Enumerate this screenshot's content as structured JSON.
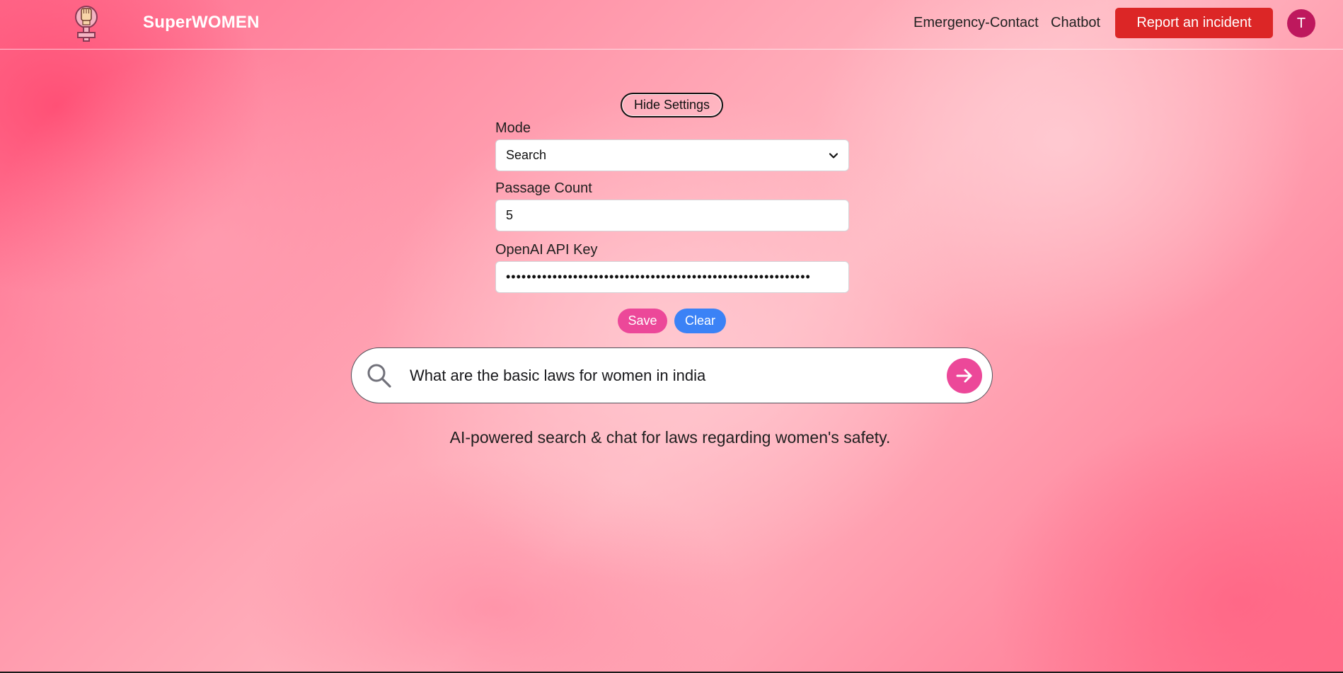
{
  "navbar": {
    "brand": "SuperWOMEN",
    "logo_icon": "female-symbol-fist-icon",
    "links": [
      "Emergency-Contact",
      "Chatbot"
    ],
    "report_button": "Report an incident",
    "avatar_initial": "T"
  },
  "settings": {
    "toggle_label": "Hide Settings",
    "mode_label": "Mode",
    "mode_value": "Search",
    "passage_count_label": "Passage Count",
    "passage_count_value": "5",
    "api_key_label": "OpenAI API Key",
    "api_key_value": "sk-xxxxxxxxxxxxxxxxxxxxxxxxxxxxxxxxxxxxxxxxxxxxxxxxxxxxxxxx",
    "save_label": "Save",
    "clear_label": "Clear"
  },
  "search": {
    "value": "What are the basic laws for women in india",
    "search_icon": "search-icon",
    "submit_icon": "arrow-right-icon"
  },
  "tagline": "AI-powered search & chat for laws regarding women's safety.",
  "colors": {
    "accent_pink": "#ec4899",
    "report_red": "#dc2626",
    "clear_blue": "#3b82f6",
    "avatar_bg": "#be185d"
  }
}
